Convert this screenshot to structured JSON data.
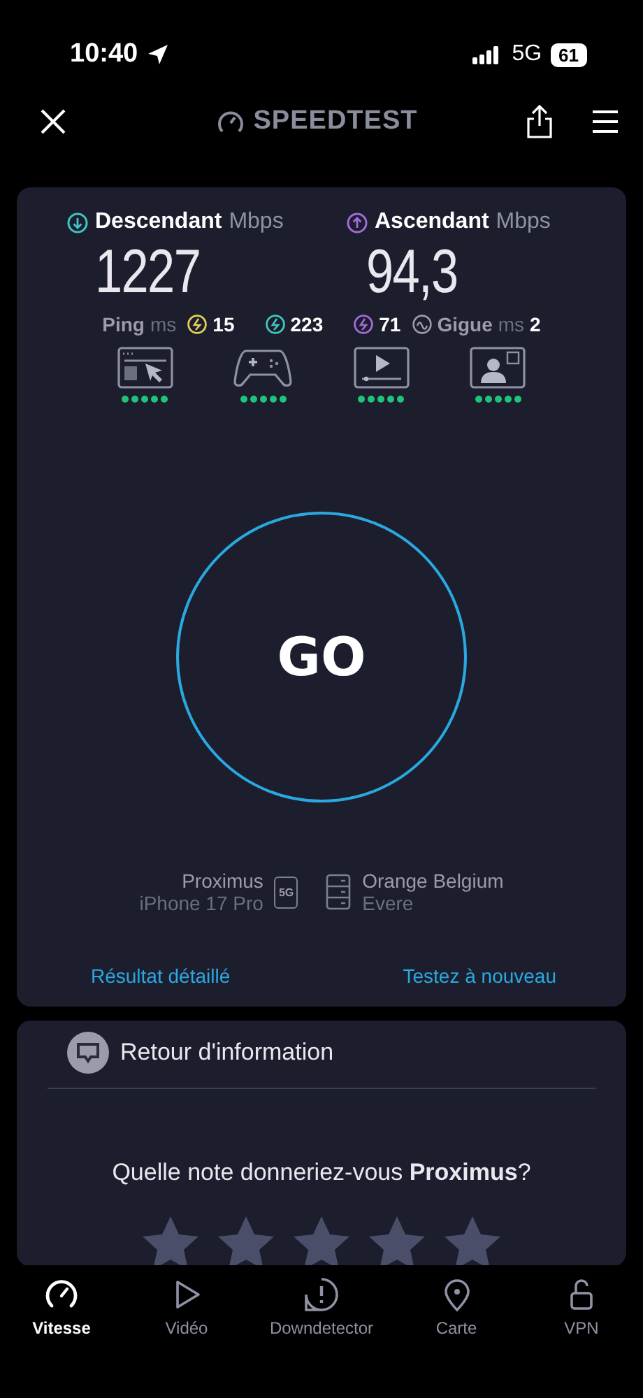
{
  "status_bar": {
    "time": "10:40",
    "network": "5G",
    "battery": "61"
  },
  "header": {
    "title": "SPEEDTEST"
  },
  "results": {
    "download": {
      "label": "Descendant",
      "unit": "Mbps",
      "value": "1227",
      "color": "#3ec6c0"
    },
    "upload": {
      "label": "Ascendant",
      "unit": "Mbps",
      "value": "94,3",
      "color": "#a46ad8"
    },
    "ping": {
      "label": "Ping",
      "unit": "ms",
      "values": [
        {
          "value": "15",
          "color": "#e4d054"
        },
        {
          "value": "223",
          "color": "#3ec6c0"
        },
        {
          "value": "71",
          "color": "#a46ad8"
        }
      ]
    },
    "jitter": {
      "label": "Gigue",
      "unit": "ms",
      "value": "2"
    },
    "activities": [
      {
        "kind": "web",
        "stars": 5
      },
      {
        "kind": "gaming",
        "stars": 5
      },
      {
        "kind": "video",
        "stars": 5
      },
      {
        "kind": "video_call",
        "stars": 5
      }
    ],
    "go_button": "GO",
    "provider": {
      "name": "Proximus",
      "device": "iPhone 17 Pro",
      "badge": "5G"
    },
    "server": {
      "name": "Orange Belgium",
      "location": "Evere"
    },
    "links": [
      "Résultat détaillé",
      "Testez à nouveau"
    ]
  },
  "feedback": {
    "title": "Retour d'information",
    "question": "Quelle note donneriez-vous **Proximus**?"
  },
  "tab_bar": [
    {
      "kind": "speed",
      "label": "Vitesse",
      "selected": true
    },
    {
      "kind": "video",
      "label": "Vidéo",
      "selected": false
    },
    {
      "kind": "alert",
      "label": "Downdetector",
      "selected": false
    },
    {
      "kind": "map",
      "label": "Carte",
      "selected": false
    },
    {
      "kind": "vpn",
      "label": "VPN",
      "selected": false
    }
  ]
}
